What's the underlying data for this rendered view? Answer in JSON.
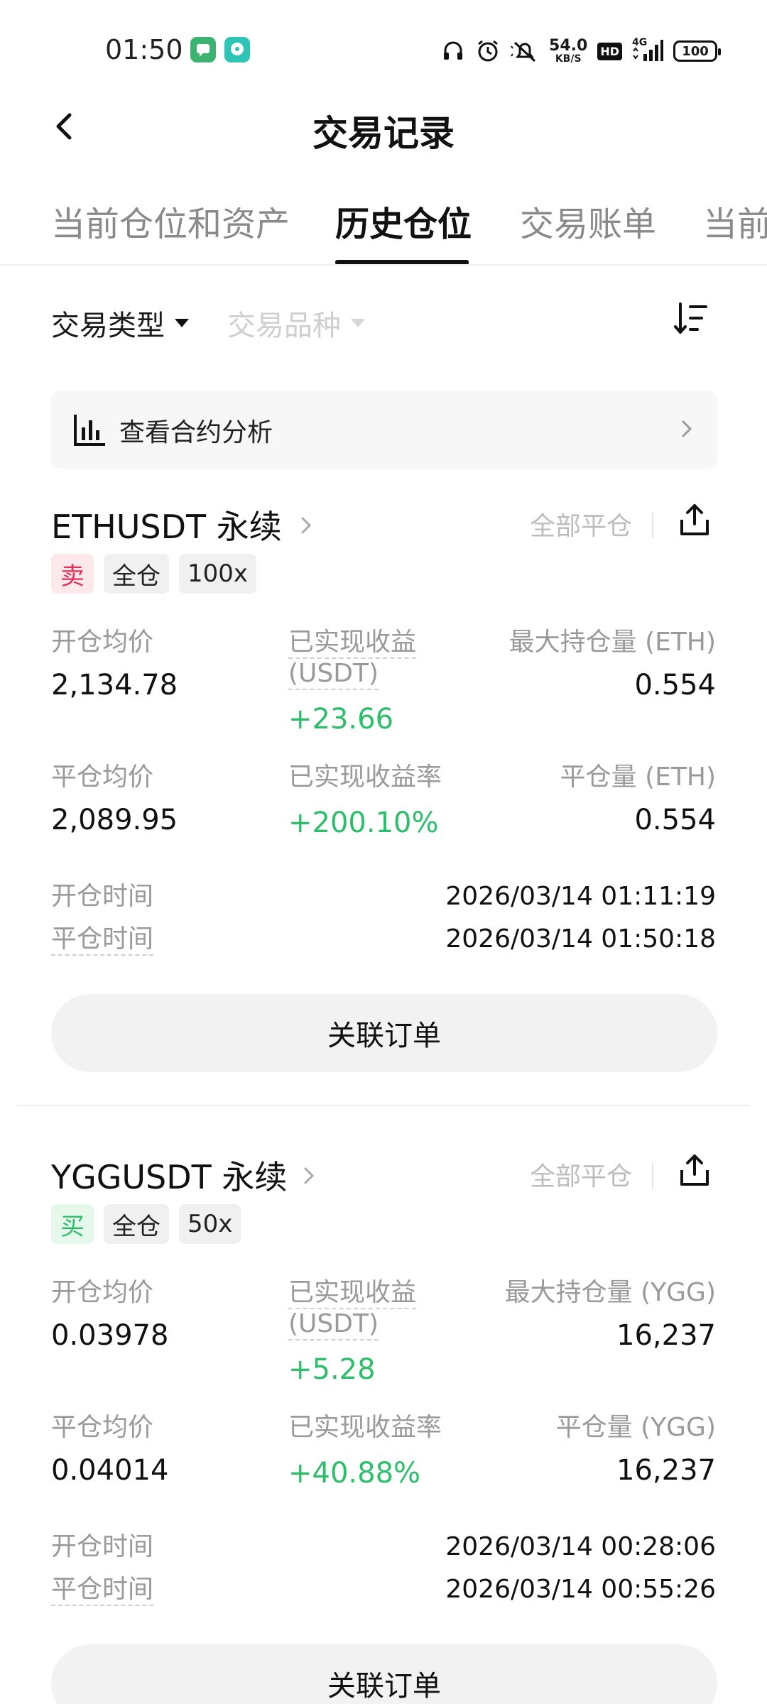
{
  "status_bar": {
    "time": "01:50",
    "net_speed_value": "54.0",
    "net_speed_unit": "KB/S",
    "hd": "HD",
    "network": "4G",
    "battery": "100",
    "icons": [
      "headphones-icon",
      "alarm-icon",
      "mute-icon",
      "signal-icon"
    ]
  },
  "header": {
    "title": "交易记录"
  },
  "tabs": [
    {
      "label": "当前仓位和资产"
    },
    {
      "label": "历史仓位"
    },
    {
      "label": "交易账单"
    },
    {
      "label": "当前"
    }
  ],
  "active_tab": 1,
  "filters": {
    "trade_type": "交易类型",
    "trade_instrument": "交易品种"
  },
  "analysis_banner": {
    "label": "查看合约分析"
  },
  "positions": [
    {
      "symbol": "ETHUSDT 永续",
      "close_all": "全部平仓",
      "side": "卖",
      "side_color": "#e0315a",
      "margin_mode": "全仓",
      "leverage": "100x",
      "open_avg_label": "开仓均价",
      "open_avg": "2,134.78",
      "realized_pnl_label": "已实现收益",
      "realized_pnl_unit": "(USDT)",
      "realized_pnl": "+23.66",
      "max_pos_label": "最大持仓量 (ETH)",
      "max_pos": "0.554",
      "close_avg_label": "平仓均价",
      "close_avg": "2,089.95",
      "realized_rate_label": "已实现收益率",
      "realized_rate": "+200.10%",
      "closed_qty_label": "平仓量 (ETH)",
      "closed_qty": "0.554",
      "open_time_label": "开仓时间",
      "open_time": "2026/03/14 01:11:19",
      "close_time_label": "平仓时间",
      "close_time": "2026/03/14 01:50:18",
      "orders_button": "关联订单"
    },
    {
      "symbol": "YGGUSDT 永续",
      "close_all": "全部平仓",
      "side": "买",
      "side_color": "#2ebd6a",
      "margin_mode": "全仓",
      "leverage": "50x",
      "open_avg_label": "开仓均价",
      "open_avg": "0.03978",
      "realized_pnl_label": "已实现收益",
      "realized_pnl_unit": "(USDT)",
      "realized_pnl": "+5.28",
      "max_pos_label": "最大持仓量 (YGG)",
      "max_pos": "16,237",
      "close_avg_label": "平仓均价",
      "close_avg": "0.04014",
      "realized_rate_label": "已实现收益率",
      "realized_rate": "+40.88%",
      "closed_qty_label": "平仓量 (YGG)",
      "closed_qty": "16,237",
      "open_time_label": "开仓时间",
      "open_time": "2026/03/14 00:28:06",
      "close_time_label": "平仓时间",
      "close_time": "2026/03/14 00:55:26",
      "orders_button": "关联订单"
    }
  ]
}
